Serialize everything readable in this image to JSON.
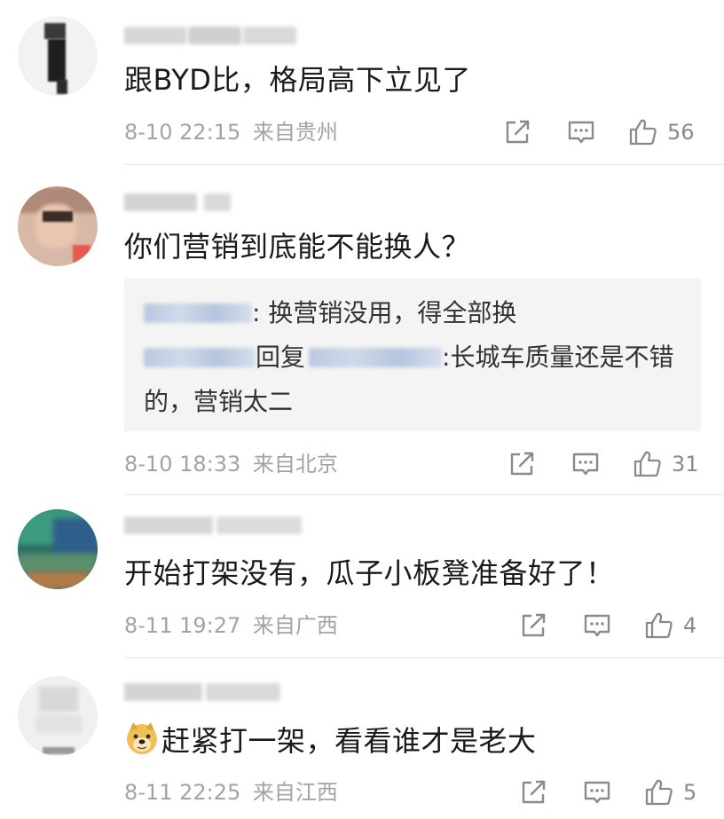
{
  "comments": [
    {
      "text": "跟BYD比，格局高下立见了",
      "time": "8-10 22:15",
      "location": "来自贵州",
      "likes": "56",
      "replies": []
    },
    {
      "text": "你们营销到底能不能换人？",
      "time": "8-10 18:33",
      "location": "来自北京",
      "likes": "31",
      "replies": [
        {
          "text": ": 换营销没用，得全部换"
        },
        {
          "reply_word": "回复",
          "text": ":长城车质量还是不错的，营销太二"
        }
      ]
    },
    {
      "text": "开始打架没有，瓜子小板凳准备好了！",
      "time": "8-11 19:27",
      "location": "来自广西",
      "likes": "4",
      "replies": []
    },
    {
      "text": "赶紧打一架，看看谁才是老大",
      "emoji": "doge-emoji",
      "time": "8-11 22:25",
      "location": "来自江西",
      "likes": "5",
      "replies": []
    }
  ],
  "icons": {
    "share": "share-icon",
    "comment": "comment-icon",
    "like": "thumbs-up-icon"
  },
  "colors": {
    "meta_text": "#a3a3a3",
    "reply_bg": "#f4f4f4",
    "icon": "#8a8a8a"
  }
}
